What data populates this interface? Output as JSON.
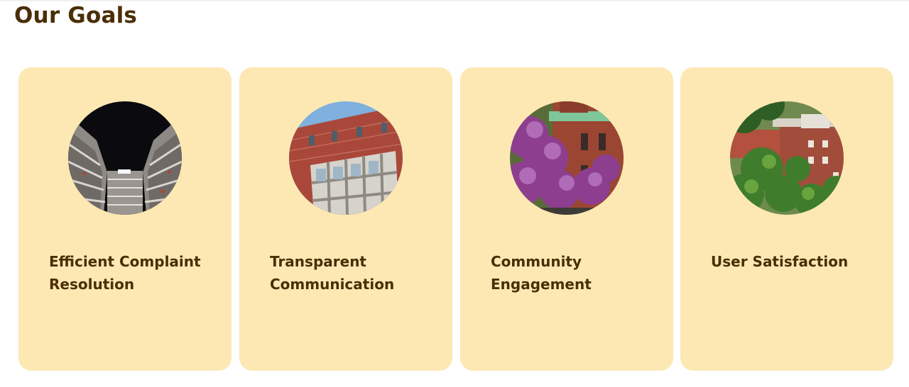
{
  "section": {
    "title": "Our Goals"
  },
  "goals": [
    {
      "label": "Efficient Complaint Resolution",
      "image": "building-atrium-night"
    },
    {
      "label": "Transparent Communication",
      "image": "brick-building-facade"
    },
    {
      "label": "Community Engagement",
      "image": "building-with-purple-trees"
    },
    {
      "label": "User Satisfaction",
      "image": "campus-buildings-aerial"
    }
  ]
}
